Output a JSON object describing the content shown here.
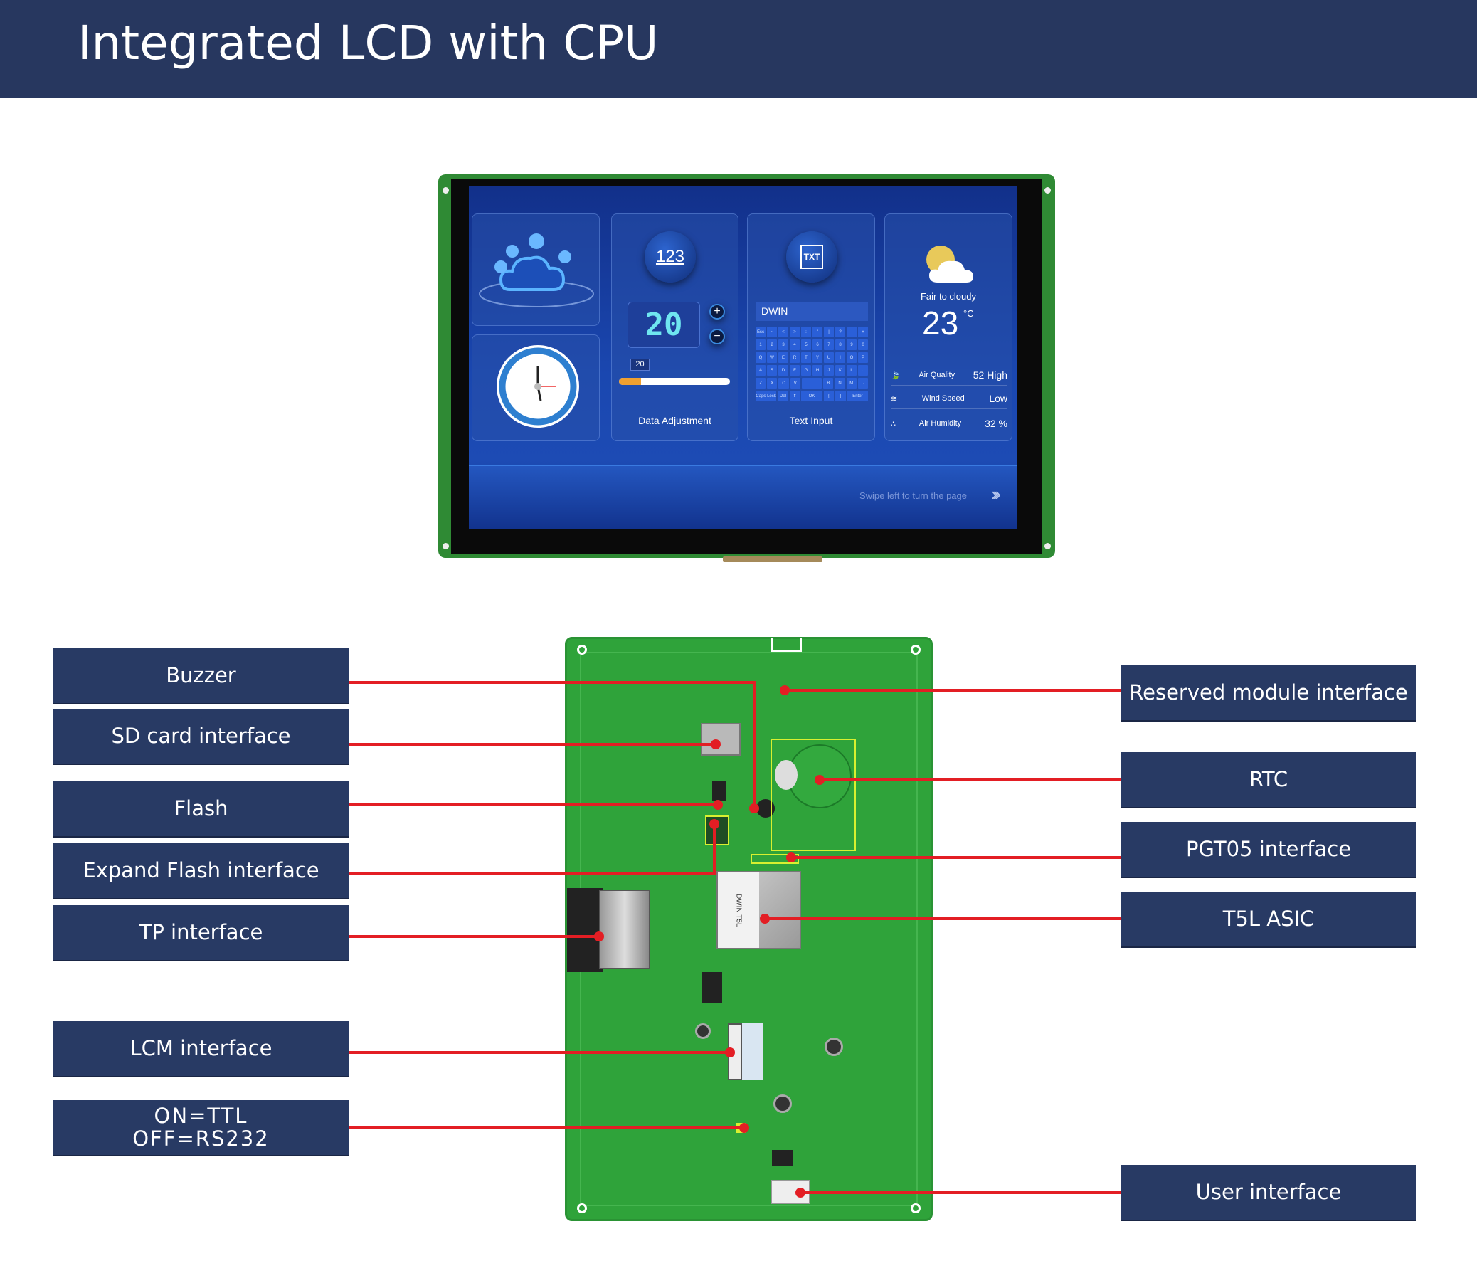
{
  "header": {
    "title": "Integrated LCD with CPU"
  },
  "screen": {
    "data_adjustment": {
      "icon_text": "123",
      "value": "20",
      "slider_value": "20",
      "slider_fraction": 0.2,
      "plus": "+",
      "minus": "−",
      "label": "Data Adjustment"
    },
    "text_input": {
      "icon_text": "TXT",
      "field_value": "DWIN",
      "label": "Text Input",
      "keys": [
        [
          "Esc",
          "~",
          "<",
          ">",
          ":",
          "\"",
          "|",
          "?",
          "_",
          "+"
        ],
        [
          "1",
          "2",
          "3",
          "4",
          "5",
          "6",
          "7",
          "8",
          "9",
          "0"
        ],
        [
          "Q",
          "W",
          "E",
          "R",
          "T",
          "Y",
          "U",
          "I",
          "O",
          "P"
        ],
        [
          "A",
          "S",
          "D",
          "F",
          "G",
          "H",
          "J",
          "K",
          "L",
          "←"
        ],
        [
          "Z",
          "X",
          "C",
          "V",
          " ",
          "B",
          "N",
          "M",
          "→"
        ],
        [
          "Caps Lock",
          "Del",
          "⬆",
          "OK",
          "{",
          "}",
          "Enter"
        ]
      ]
    },
    "weather": {
      "condition": "Fair to cloudy",
      "temperature": "23",
      "unit": "°C",
      "rows": [
        {
          "label": "Air Quality",
          "value": "52 High"
        },
        {
          "label": "Wind Speed",
          "value": "Low"
        },
        {
          "label": "Air Humidity",
          "value": "32 %"
        }
      ]
    },
    "swipe_hint": "Swipe left to turn the page",
    "swipe_arrows": "›››"
  },
  "labels": {
    "left": [
      "Buzzer",
      "SD card interface",
      "Flash",
      "Expand Flash interface",
      "TP interface",
      "LCM interface",
      "ON=TTL\nOFF=RS232"
    ],
    "right": [
      "Reserved module interface",
      "RTC",
      "PGT05 interface",
      "T5L ASIC",
      "User interface"
    ]
  },
  "pcb": {
    "chip_text": "DWIN T5L"
  },
  "colors": {
    "header": "#27375f",
    "label_bg": "#283a64",
    "leader_line": "#e31e24",
    "pcb": "#2fa33a",
    "screen": "#1a47b0"
  }
}
